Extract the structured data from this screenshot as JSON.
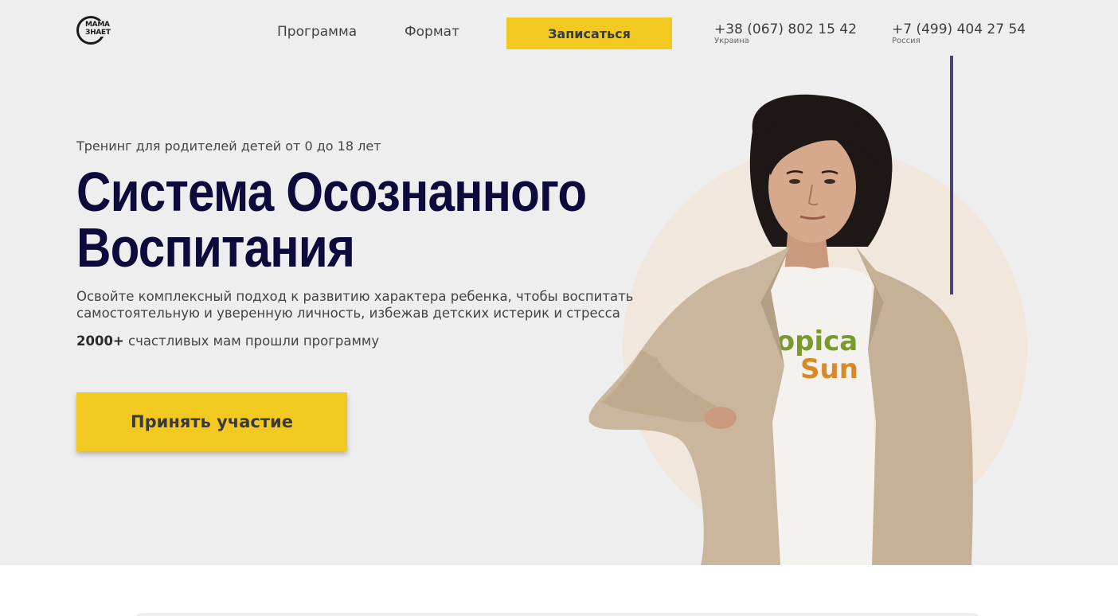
{
  "header": {
    "logo_text_line1": "МАМА",
    "logo_text_line2": "ЗНАЕТ",
    "nav": [
      {
        "label": "Программа"
      },
      {
        "label": "Формат"
      }
    ],
    "signup_button": "Записаться",
    "phones": [
      {
        "number": "+38 (067) 802 15 42",
        "country": "Украина"
      },
      {
        "number": "+7 (499) 404 27 54",
        "country": "Россия"
      }
    ]
  },
  "hero": {
    "subtitle": "Тренинг для родителей детей от 0 до 18 лет",
    "title_line1": "Система Осознанного",
    "title_line2": "Воспитания",
    "description": "Освойте комплексный подход к развитию характера ребенка, чтобы воспитать самостоятельную и уверенную личность, избежав детских истерик и стресса",
    "stat_number": "2000+",
    "stat_text": " счастливых мам прошли программу",
    "cta_button": "Принять участие",
    "shirt_text_line1": "ropica",
    "shirt_text_line2": "Sun"
  },
  "colors": {
    "accent": "#f2c920",
    "title": "#0d0b3b",
    "hero_bg": "#eeeeef",
    "circle": "#f1e7dc",
    "line": "#4a4470"
  },
  "icons": [
    "logo-icon",
    "person-photo"
  ]
}
